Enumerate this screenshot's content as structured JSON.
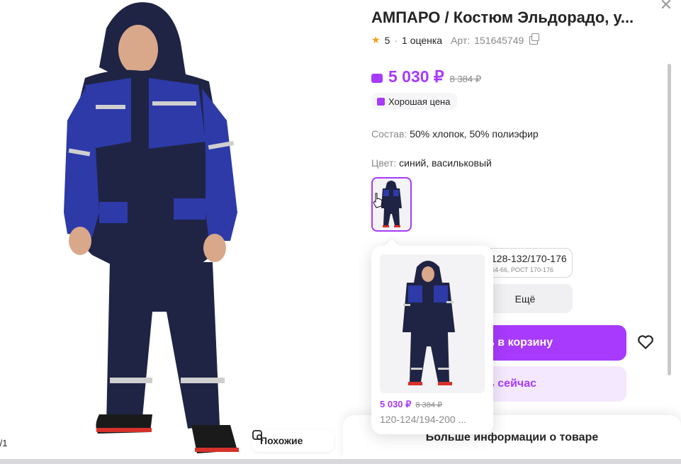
{
  "product": {
    "title": "АМПАРО / Костюм Эльдорадо, у...",
    "rating": "5",
    "reviews": "1 оценка",
    "article_label": "Арт:",
    "article": "151645749",
    "price": "5 030 ₽",
    "old_price": "8 384 ₽",
    "good_price_badge": "Хорошая цена",
    "composition_label": "Состав:",
    "composition": "50% хлопок, 50% полиэфир",
    "color_label": "Цвет:",
    "color": "синий, васильковый"
  },
  "size": {
    "selected_main": "128-132/170-176",
    "selected_sub": "64-66, РОСТ 170-176",
    "more_label": "Ещё"
  },
  "actions": {
    "cart_label": "ь в корзину",
    "buy_now_label": "ь сейчас",
    "more_info_label": "Больше информации о товаре"
  },
  "gallery": {
    "counter": "/1",
    "similar_label": "Похожие"
  },
  "tooltip": {
    "price": "5 030 ₽",
    "old_price": "8 384 ₽",
    "size": "120-124/194-200 ..."
  },
  "colors": {
    "accent": "#a73afd",
    "accent_light": "#f4e8ff",
    "star": "#f59f1c",
    "navy": "#1f2444",
    "royal_blue": "#2d3aa8"
  },
  "icons": [
    "close-icon",
    "star-icon",
    "copy-icon",
    "wallet-icon",
    "thumb-up-icon",
    "heart-icon",
    "search-similar-icon",
    "cursor-hand-icon"
  ]
}
